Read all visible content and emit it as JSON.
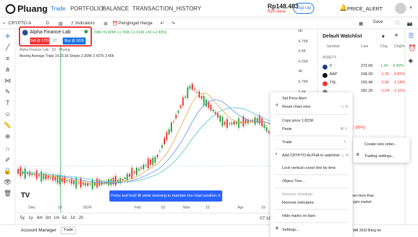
{
  "app": {
    "name": "Pluang"
  },
  "nav": {
    "items": [
      "Trade",
      "PORTFOLIO",
      "BALANCE",
      "TRANSACTION_HISTORY"
    ],
    "active": "Trade"
  },
  "account": {
    "balance": "Rp148.483",
    "sub": "Rp0 dana",
    "topup": "Top Up",
    "price_alert": "PRICE_ALERT"
  },
  "toolbar": {
    "symbol": "CRYPTO:A",
    "interval": "D",
    "indicators": "Indicators",
    "alert": "Pengingat Harga",
    "save": "Save"
  },
  "panel": {
    "title": "Alpha Finance Lab",
    "sell": "Sell @ 1791",
    "buy": "Buy @ 1818",
    "spread": "27"
  },
  "chart": {
    "ohlc": "1.768K H1.829K L1.763K C1.819K +50 (+2.83%)",
    "indicator1": "Alpha Finance Lab · 1D · Pluang",
    "indicator2": "Moving Average Triple  14.23.36 Simple  2.358K  2.427K  2.45K",
    "price_label": "1.823K",
    "yticks": [
      "5K",
      "4.75K",
      "4.5K",
      "4.25K",
      "4K",
      "3.75K",
      "3.5K",
      "3.25K",
      "3K",
      "2.75K",
      "2.5K",
      "2.25K",
      "2K",
      "1.75K",
      "1.5K",
      "1.25K",
      "1K",
      "750"
    ],
    "xticks": [
      "Dec",
      "15",
      "2024",
      "Feb",
      "15",
      "Mar",
      "15",
      "Apr",
      "15"
    ],
    "toast": "Press and hold ⌘ while zooming to maintain the chart position",
    "timereadout": "07:18:33",
    "utc": "UTC+7"
  },
  "chart_data": {
    "type": "line",
    "title": "",
    "xlabel": "",
    "ylabel": "",
    "x": [
      "Dec",
      "15",
      "2024",
      "Feb",
      "15",
      "Mar",
      "15",
      "Apr",
      "15"
    ],
    "series": [
      {
        "values": [
          1.7,
          1.55,
          1.4,
          1.5,
          2.0,
          3.7,
          2.8,
          2.9,
          1.8
        ]
      },
      {
        "values": [
          1.9,
          1.7,
          1.55,
          1.6,
          1.8,
          2.6,
          2.9,
          2.8,
          2.2
        ]
      }
    ]
  },
  "periods": [
    "5y",
    "1y",
    "6m",
    "3m",
    "1m",
    "5d",
    "1d",
    "2h"
  ],
  "bottom": {
    "account_manager": "Account Manager",
    "trade": "Trade"
  },
  "watchlist": {
    "title": "Default Watchlist",
    "headers": [
      "Symbol",
      "Last",
      "Chg",
      "Chg%"
    ],
    "section": "ASSETS",
    "rows": [
      {
        "sym": "V",
        "last": "272.69",
        "chg": "1.34",
        "pct": "0.49%",
        "color": "#1a3a8f",
        "pos": true
      },
      {
        "sym": "AAP",
        "last": "168.00",
        "chg": "-1.36",
        "pct": "-0.81%",
        "color": "#111",
        "pos": false
      },
      {
        "sym": "TSL",
        "last": "155.46",
        "chg": "-1.86",
        "pct": "-1.18%",
        "color": "#e33",
        "pos": false
      },
      {
        "sym": "",
        "last": "181.26",
        "chg": "-2.04",
        "pct": "-1.11%",
        "color": "#888",
        "pos": false
      }
    ]
  },
  "context_menu": {
    "items": [
      "Set Price Alert",
      "Reset chart view",
      "Copy price 1.823K",
      "Paste",
      "Trade",
      "Add CRYPTO:ALPHA to watchlist",
      "Lock vertical cursor line by time",
      "Object Tree...",
      "Remove drawings",
      "Remove indicators",
      "Hide marks on bars",
      "Settings..."
    ],
    "shortcuts": {
      "reset": "⌥ R",
      "paste": "⌘ V",
      "add": "⌥ W"
    }
  },
  "submenu": {
    "items": [
      "Create new order...",
      "Trading settings..."
    ]
  },
  "news": {
    "pct": "(-16%)",
    "line1": "13%, down more than",
    "line2": "pooks crypto market",
    "line3": "s: What Will 2022 Bring for"
  }
}
